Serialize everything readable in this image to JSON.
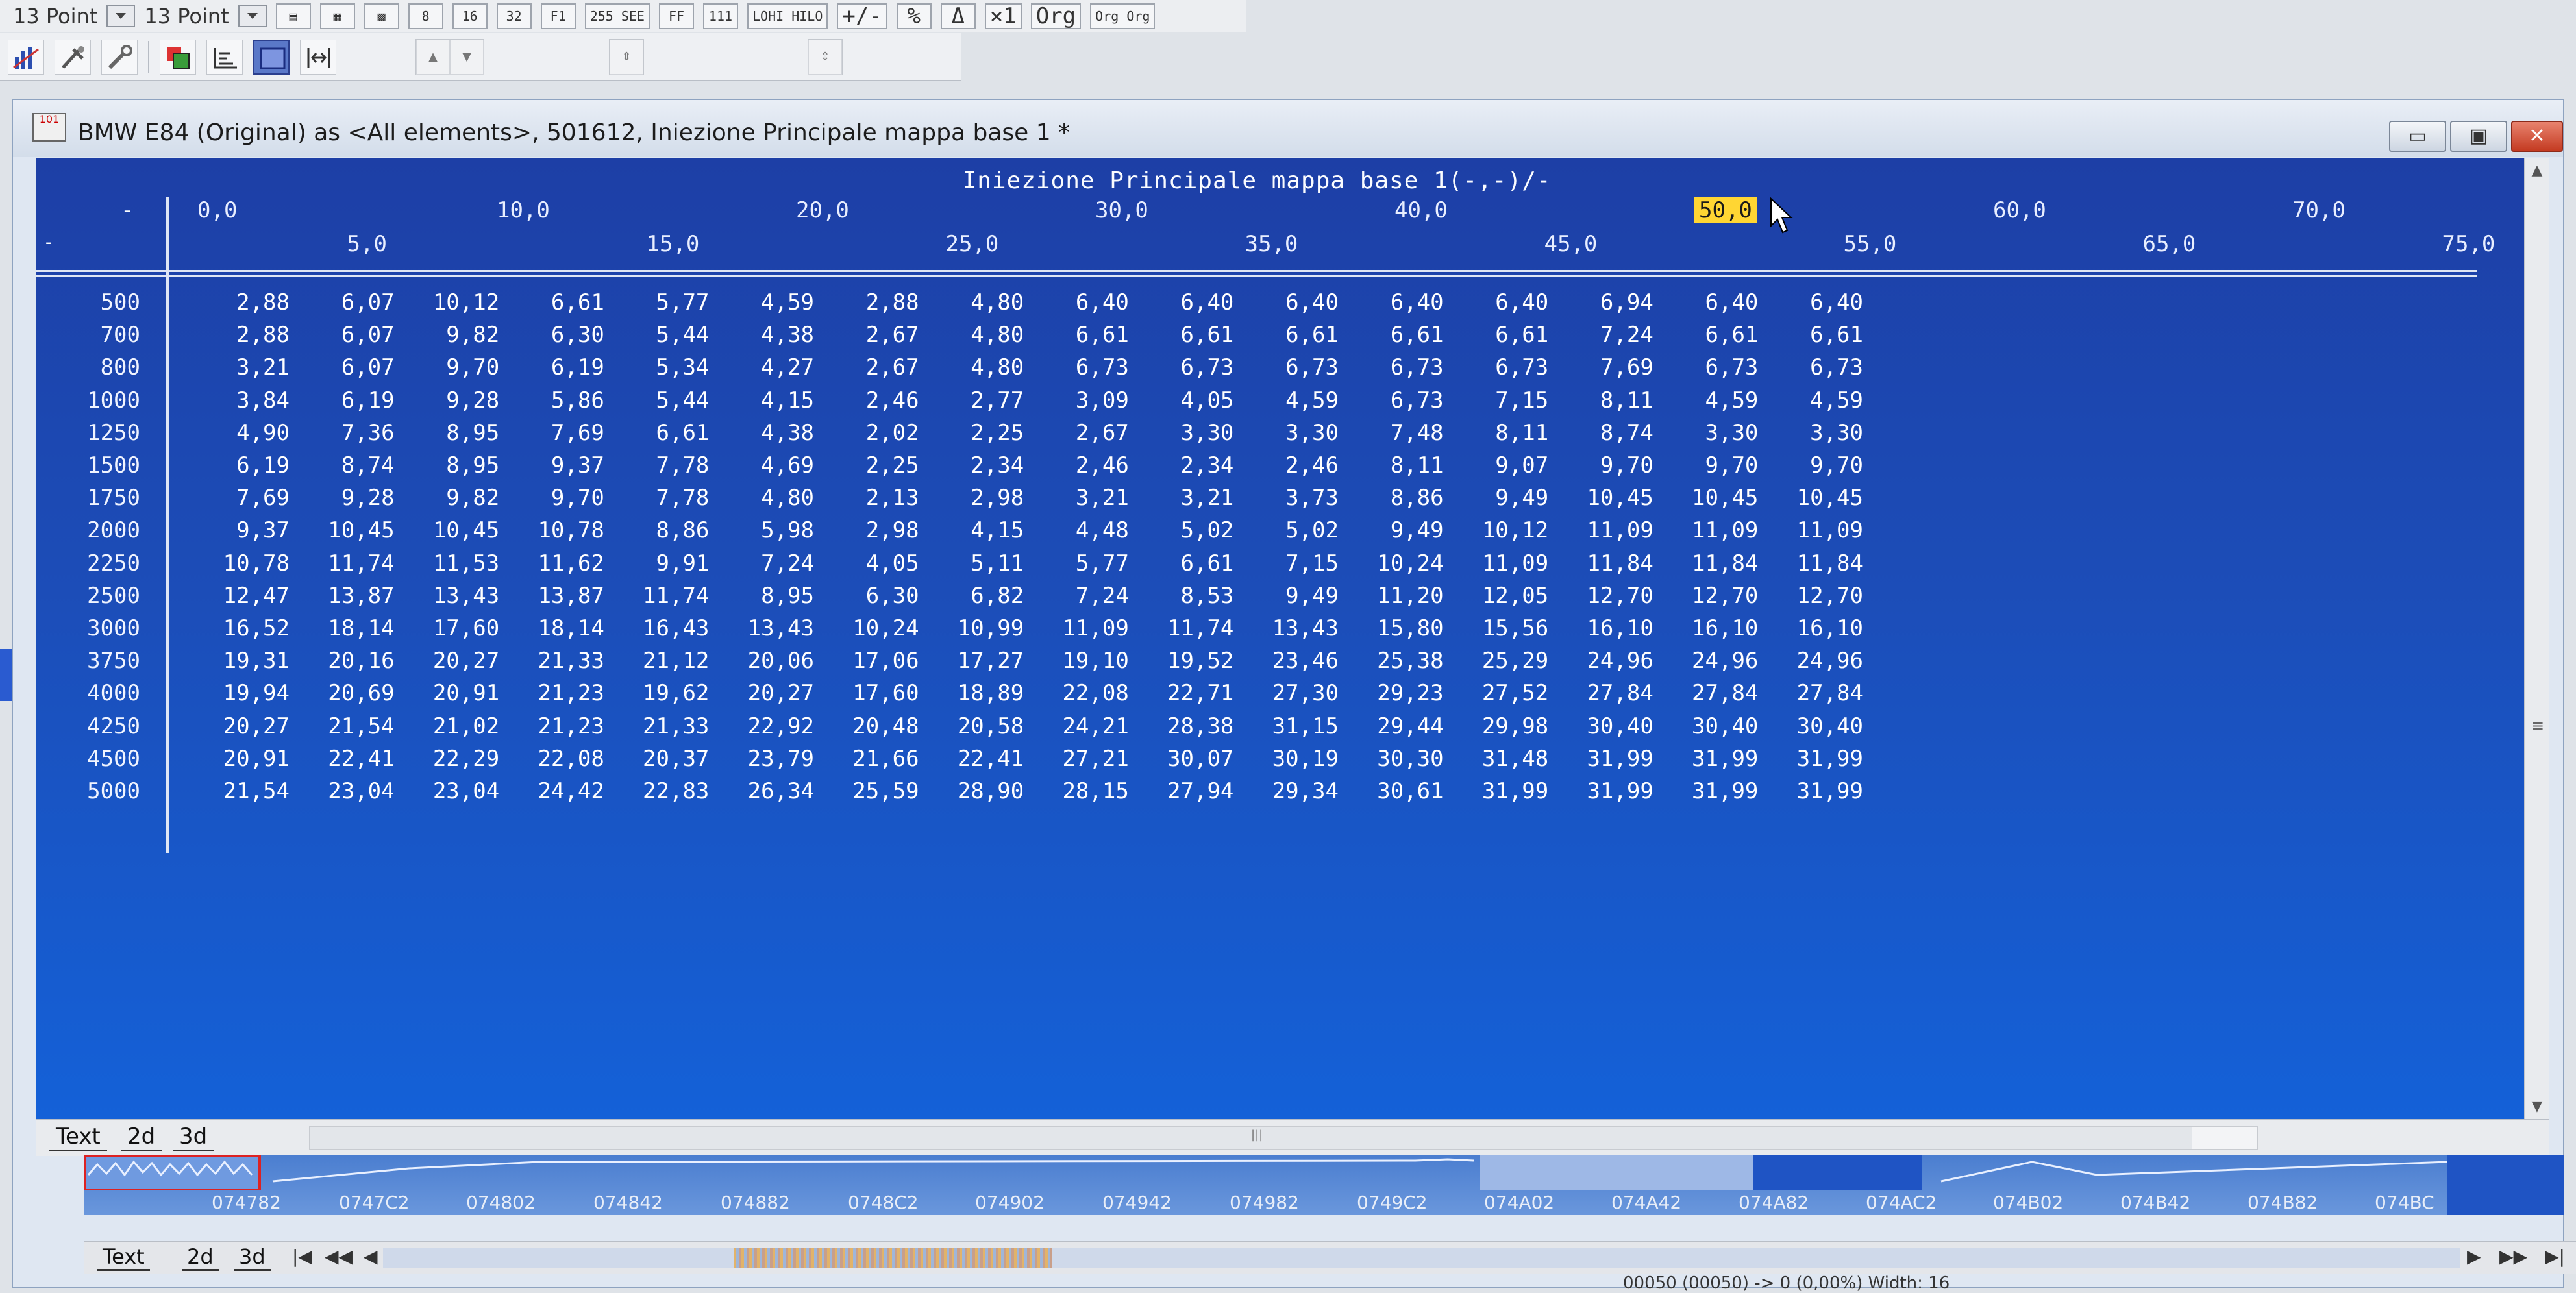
{
  "toolbar": {
    "point_size_1": "13 Point",
    "point_size_2": "13 Point",
    "bit_buttons": [
      "8",
      "16",
      "32",
      "F1"
    ],
    "format_buttons": [
      "255 SEE",
      "FF",
      "111"
    ],
    "hilo_label": "LOHI HILO",
    "sign_label": "+/-",
    "percent_label": "%",
    "delta_label": "Δ",
    "x1_label": "×1",
    "orig_label": "Org",
    "orig2_label": "Org Org"
  },
  "window": {
    "title": "BMW E84 (Original) as <All elements>, 501612, Iniezione Principale mappa base 1 *",
    "min_glyph": "▭",
    "max_glyph": "▣",
    "close_glyph": "✕"
  },
  "map": {
    "name": "Iniezione Principale mappa base 1(-,-)/-",
    "corner_top": "-",
    "corner_bottom": "-",
    "x_axis": [
      "0,0",
      "5,0",
      "10,0",
      "15,0",
      "20,0",
      "25,0",
      "30,0",
      "35,0",
      "40,0",
      "45,0",
      "50,0",
      "55,0",
      "60,0",
      "65,0",
      "70,0",
      "75,0"
    ],
    "selected_x_index": 10,
    "y_axis": [
      "500",
      "700",
      "800",
      "1000",
      "1250",
      "1500",
      "1750",
      "2000",
      "2250",
      "2500",
      "3000",
      "3750",
      "4000",
      "4250",
      "4500",
      "5000"
    ],
    "values": [
      [
        "2,88",
        "6,07",
        "10,12",
        "6,61",
        "5,77",
        "4,59",
        "2,88",
        "4,80",
        "6,40",
        "6,40",
        "6,40",
        "6,40",
        "6,40",
        "6,94",
        "6,40",
        "6,40"
      ],
      [
        "2,88",
        "6,07",
        "9,82",
        "6,30",
        "5,44",
        "4,38",
        "2,67",
        "4,80",
        "6,61",
        "6,61",
        "6,61",
        "6,61",
        "6,61",
        "7,24",
        "6,61",
        "6,61"
      ],
      [
        "3,21",
        "6,07",
        "9,70",
        "6,19",
        "5,34",
        "4,27",
        "2,67",
        "4,80",
        "6,73",
        "6,73",
        "6,73",
        "6,73",
        "6,73",
        "7,69",
        "6,73",
        "6,73"
      ],
      [
        "3,84",
        "6,19",
        "9,28",
        "5,86",
        "5,44",
        "4,15",
        "2,46",
        "2,77",
        "3,09",
        "4,05",
        "4,59",
        "6,73",
        "7,15",
        "8,11",
        "4,59",
        "4,59"
      ],
      [
        "4,90",
        "7,36",
        "8,95",
        "7,69",
        "6,61",
        "4,38",
        "2,02",
        "2,25",
        "2,67",
        "3,30",
        "3,30",
        "7,48",
        "8,11",
        "8,74",
        "3,30",
        "3,30"
      ],
      [
        "6,19",
        "8,74",
        "8,95",
        "9,37",
        "7,78",
        "4,69",
        "2,25",
        "2,34",
        "2,46",
        "2,34",
        "2,46",
        "8,11",
        "9,07",
        "9,70",
        "9,70",
        "9,70"
      ],
      [
        "7,69",
        "9,28",
        "9,82",
        "9,70",
        "7,78",
        "4,80",
        "2,13",
        "2,98",
        "3,21",
        "3,21",
        "3,73",
        "8,86",
        "9,49",
        "10,45",
        "10,45",
        "10,45"
      ],
      [
        "9,37",
        "10,45",
        "10,45",
        "10,78",
        "8,86",
        "5,98",
        "2,98",
        "4,15",
        "4,48",
        "5,02",
        "5,02",
        "9,49",
        "10,12",
        "11,09",
        "11,09",
        "11,09"
      ],
      [
        "10,78",
        "11,74",
        "11,53",
        "11,62",
        "9,91",
        "7,24",
        "4,05",
        "5,11",
        "5,77",
        "6,61",
        "7,15",
        "10,24",
        "11,09",
        "11,84",
        "11,84",
        "11,84"
      ],
      [
        "12,47",
        "13,87",
        "13,43",
        "13,87",
        "11,74",
        "8,95",
        "6,30",
        "6,82",
        "7,24",
        "8,53",
        "9,49",
        "11,20",
        "12,05",
        "12,70",
        "12,70",
        "12,70"
      ],
      [
        "16,52",
        "18,14",
        "17,60",
        "18,14",
        "16,43",
        "13,43",
        "10,24",
        "10,99",
        "11,09",
        "11,74",
        "13,43",
        "15,80",
        "15,56",
        "16,10",
        "16,10",
        "16,10"
      ],
      [
        "19,31",
        "20,16",
        "20,27",
        "21,33",
        "21,12",
        "20,06",
        "17,06",
        "17,27",
        "19,10",
        "19,52",
        "23,46",
        "25,38",
        "25,29",
        "24,96",
        "24,96",
        "24,96"
      ],
      [
        "19,94",
        "20,69",
        "20,91",
        "21,23",
        "19,62",
        "20,27",
        "17,60",
        "18,89",
        "22,08",
        "22,71",
        "27,30",
        "29,23",
        "27,52",
        "27,84",
        "27,84",
        "27,84"
      ],
      [
        "20,27",
        "21,54",
        "21,02",
        "21,23",
        "21,33",
        "22,92",
        "20,48",
        "20,58",
        "24,21",
        "28,38",
        "31,15",
        "29,44",
        "29,98",
        "30,40",
        "30,40",
        "30,40"
      ],
      [
        "20,91",
        "22,41",
        "22,29",
        "22,08",
        "20,37",
        "23,79",
        "21,66",
        "22,41",
        "27,21",
        "30,07",
        "30,19",
        "30,30",
        "31,48",
        "31,99",
        "31,99",
        "31,99"
      ],
      [
        "21,54",
        "23,04",
        "23,04",
        "24,42",
        "22,83",
        "26,34",
        "25,59",
        "28,90",
        "28,15",
        "27,94",
        "29,34",
        "30,61",
        "31,99",
        "31,99",
        "31,99",
        "31,99"
      ]
    ]
  },
  "tabs": [
    "Text",
    "2d",
    "3d"
  ],
  "hex_addresses": [
    "074782",
    "0747C2",
    "074802",
    "074842",
    "074882",
    "0748C2",
    "074902",
    "074942",
    "074982",
    "0749C2",
    "074A02",
    "074A42",
    "074A82",
    "074AC2",
    "074B02",
    "074B42",
    "074B82",
    "074BC"
  ],
  "status_text": "00050 (00050)   -> 0 (0,00%)   Width: 16"
}
